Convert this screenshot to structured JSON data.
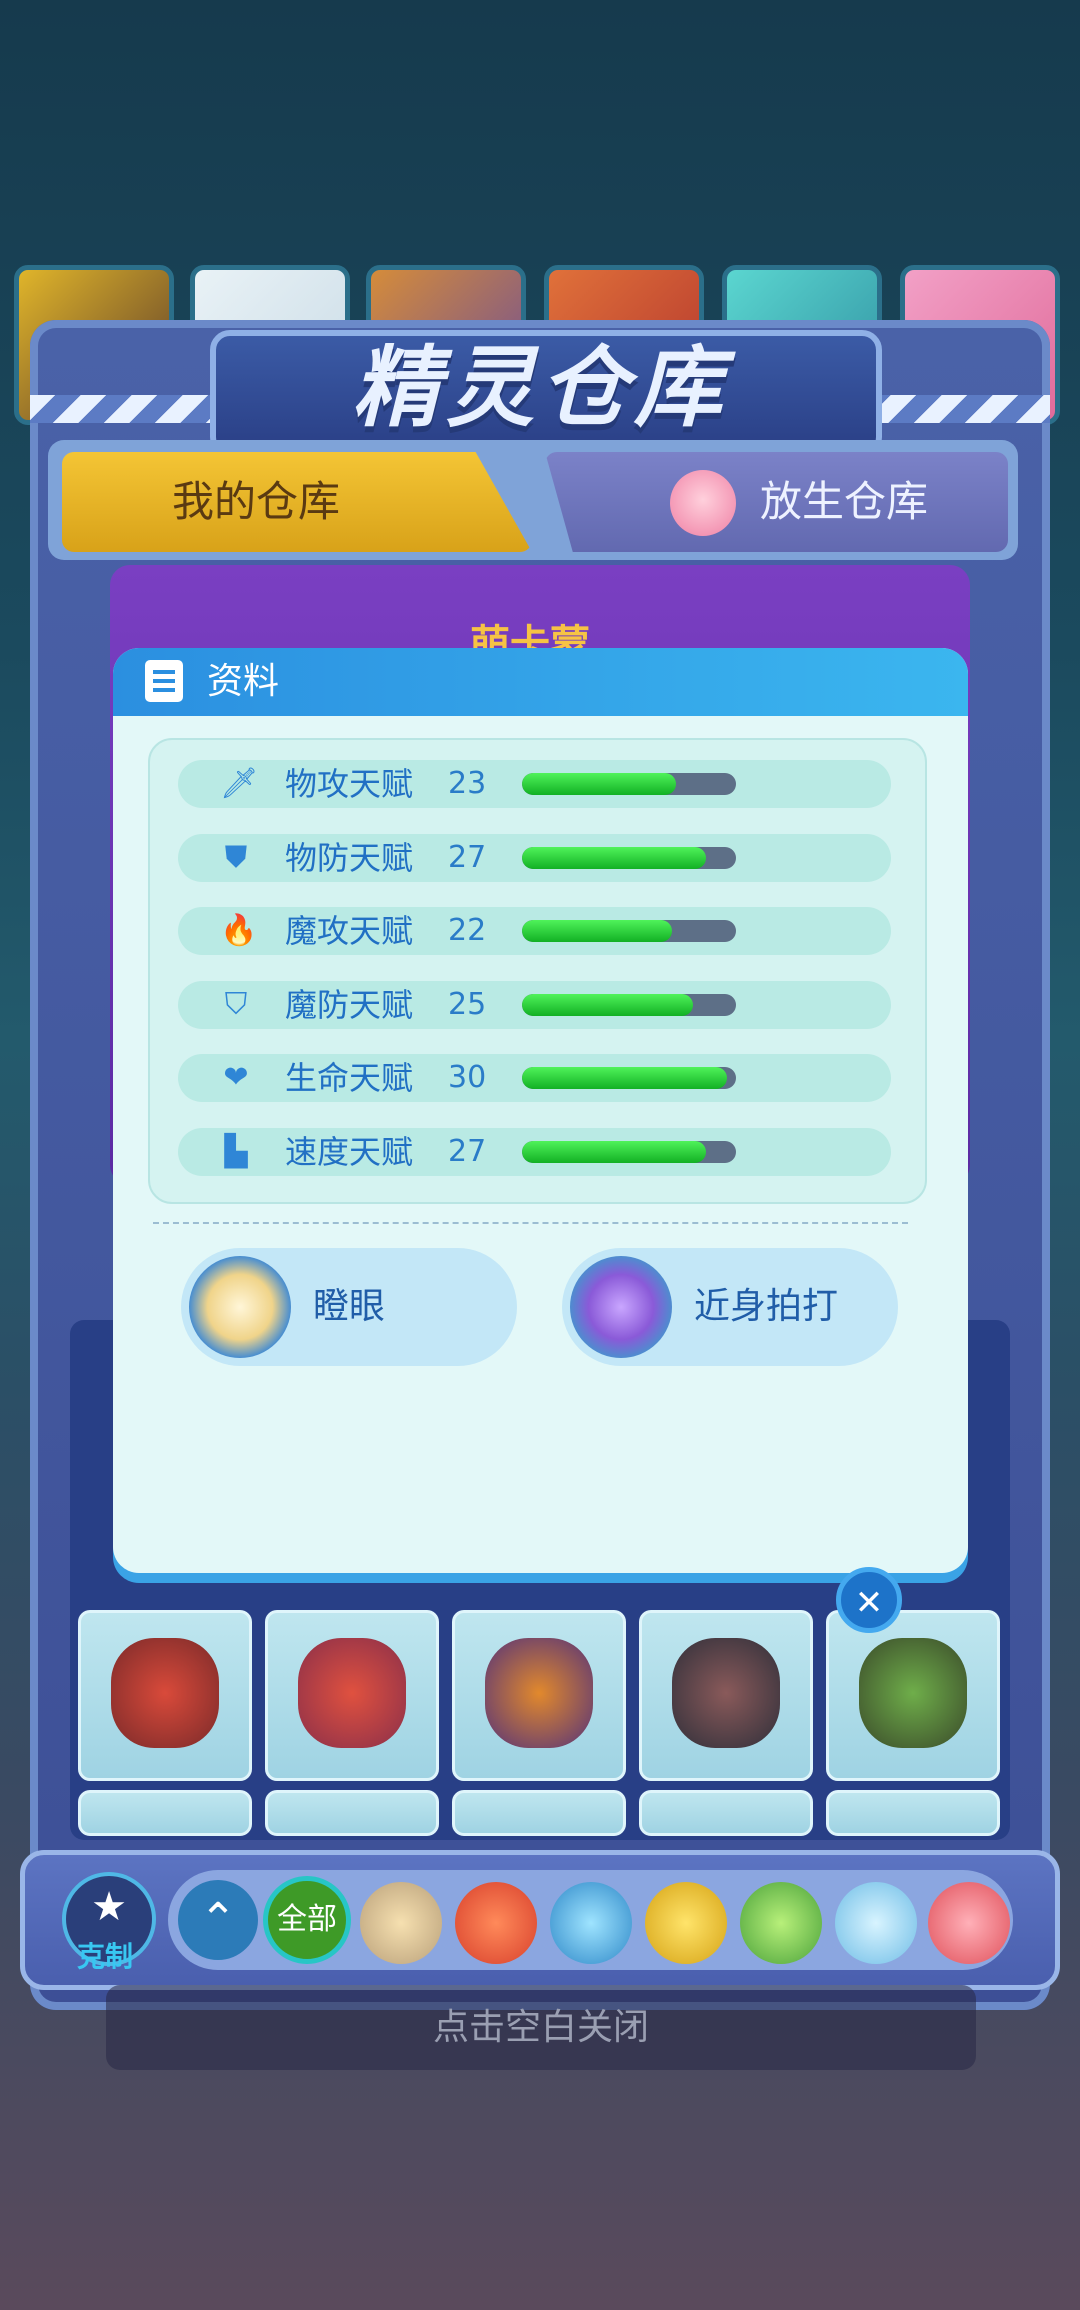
{
  "header": {
    "title": "精灵仓库"
  },
  "tabs": [
    {
      "label": "我的仓库",
      "active": true
    },
    {
      "label": "放生仓库",
      "active": false
    }
  ],
  "creature": {
    "name_partial": "萌卡蒙"
  },
  "dialog": {
    "title": "资料",
    "stats": [
      {
        "icon": "sword-icon",
        "label": "物攻天赋",
        "value": "23",
        "fraction": 0.72
      },
      {
        "icon": "shield-icon",
        "label": "物防天赋",
        "value": "27",
        "fraction": 0.86
      },
      {
        "icon": "flame-icon",
        "label": "魔攻天赋",
        "value": "22",
        "fraction": 0.7
      },
      {
        "icon": "magic-shield-icon",
        "label": "魔防天赋",
        "value": "25",
        "fraction": 0.8
      },
      {
        "icon": "heart-plus-icon",
        "label": "生命天赋",
        "value": "30",
        "fraction": 0.96
      },
      {
        "icon": "boot-icon",
        "label": "速度天赋",
        "value": "27",
        "fraction": 0.86
      }
    ],
    "skills": [
      {
        "label": "瞪眼",
        "icon": "normal-type-emblem-icon"
      },
      {
        "label": "近身拍打",
        "icon": "bat-type-emblem-icon"
      }
    ]
  },
  "filter": {
    "counter_label": "克制",
    "all_label": "全部",
    "elements": [
      "normal-icon",
      "fire-icon",
      "water-icon",
      "electric-icon",
      "grass-icon",
      "ice-icon",
      "fighting-icon"
    ]
  },
  "close_hint": "点击空白关闭",
  "colors": {
    "accent": "#2b8fe0",
    "bar_fill": "#1ed12f",
    "tab_active": "#f4c535"
  }
}
